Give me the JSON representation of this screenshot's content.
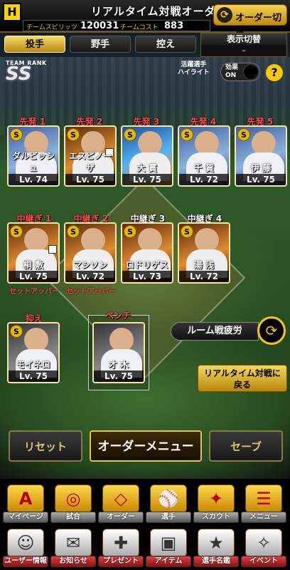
{
  "header": {
    "logo": "H",
    "title": "リアルタイム対戦オーダー",
    "team_spirit_label": "チームスピリッツ",
    "team_spirit_value": "120031",
    "team_cost_label": "チームコスト",
    "team_cost_value": "883",
    "order_switch_label": "オーダー切替"
  },
  "tabs": [
    {
      "label": "投手"
    },
    {
      "label": "野手"
    },
    {
      "label": "控え"
    }
  ],
  "display_switch": {
    "label": "表示切替",
    "value": "–"
  },
  "team_rank": {
    "label": "TEAM RANK",
    "value": "SS"
  },
  "highlight": {
    "label_line1": "活躍選手",
    "label_line2": "ハイライト"
  },
  "effect": {
    "label_line1": "効果",
    "label_line2": "ON"
  },
  "help_label": "?",
  "starters": [
    {
      "slot": "先発 1",
      "name": "ダルビッシュ",
      "level": "Lv. 74",
      "rarity": "S"
    },
    {
      "slot": "先発 2",
      "name": "エスピノーザ",
      "level": "Lv. 75",
      "rarity": "S"
    },
    {
      "slot": "先発 3",
      "name": "大 貫",
      "level": "Lv. 75",
      "rarity": "S"
    },
    {
      "slot": "先発 4",
      "name": "千 賀",
      "level": "Lv. 72",
      "rarity": "S"
    },
    {
      "slot": "先発 5",
      "name": "伊 藤",
      "level": "Lv. 75",
      "rarity": "S"
    }
  ],
  "relievers": [
    {
      "slot": "中継ぎ 1",
      "name": "桐 敷",
      "level": "Lv. 75",
      "rarity": "S",
      "role": "セットアッパー"
    },
    {
      "slot": "中継ぎ 2",
      "name": "マシソン",
      "level": "Lv. 72",
      "rarity": "S",
      "role": "セットアッパー"
    },
    {
      "slot": "中継ぎ 3",
      "name": "ロドリゲス",
      "level": "Lv. 73",
      "rarity": "S",
      "role": ""
    },
    {
      "slot": "中継ぎ 4",
      "name": "湯 浅",
      "level": "Lv. 72",
      "rarity": "S",
      "role": ""
    }
  ],
  "closer": {
    "slot": "抑え",
    "name": "モイネロ",
    "level": "Lv. 75",
    "rarity": "S"
  },
  "bench": {
    "slot": "ベンチ",
    "name": "才 木",
    "level": "Lv. 75"
  },
  "room_fatigue_label": "ルーム戦疲労",
  "back_button_line1": "リアルタイム対戦に",
  "back_button_line2": "戻る",
  "buttons": {
    "reset": "リセット",
    "order_menu": "オーダーメニュー",
    "save": "セーブ"
  },
  "menu_row1": [
    {
      "label": "マイページ",
      "icon": "A"
    },
    {
      "label": "試合",
      "icon": "◎"
    },
    {
      "label": "オーダー",
      "icon": "◇"
    },
    {
      "label": "選手",
      "icon": "⚾"
    },
    {
      "label": "スカウト",
      "icon": "✦"
    },
    {
      "label": "メニュー",
      "icon": "☰"
    }
  ],
  "menu_row2": [
    {
      "label": "ユーザー情報",
      "icon": "☺"
    },
    {
      "label": "お知らせ",
      "icon": "✉"
    },
    {
      "label": "プレゼント",
      "icon": "✚"
    },
    {
      "label": "アイテム",
      "icon": "▣"
    },
    {
      "label": "選手名鑑",
      "icon": "★"
    },
    {
      "label": "イベント",
      "icon": "✧"
    }
  ]
}
